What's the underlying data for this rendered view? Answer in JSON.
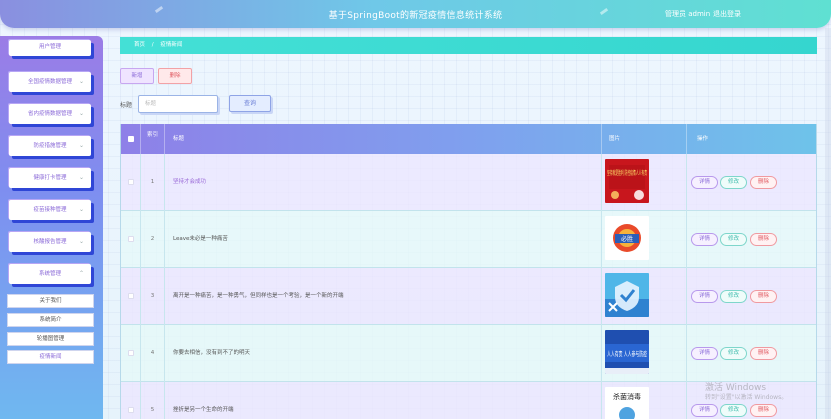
{
  "header": {
    "title": "基于SpringBoot的新冠疫情信息统计系统",
    "user": "管理员 admin",
    "logout": "退出登录"
  },
  "sidebar": {
    "menus": [
      {
        "label": "用户管理"
      },
      {
        "label": "全国疫情数据管理"
      },
      {
        "label": "省内疫情数据管理"
      },
      {
        "label": "防疫措施管理"
      },
      {
        "label": "健康打卡管理"
      },
      {
        "label": "疫苗接种管理"
      },
      {
        "label": "核酸报告管理"
      },
      {
        "label": "系统管理"
      }
    ],
    "submenu": [
      {
        "label": "关于我们"
      },
      {
        "label": "系统简介"
      },
      {
        "label": "轮播图管理"
      },
      {
        "label": "疫情新闻"
      }
    ]
  },
  "breadcrumb": {
    "home": "首页",
    "current": "疫情新闻"
  },
  "toolbar": {
    "add": "新增",
    "delete": "删除"
  },
  "search": {
    "label": "标题",
    "placeholder": "标题",
    "button": "查询"
  },
  "table": {
    "headers": {
      "index": "索引",
      "title": "标题",
      "image": "图片",
      "ops": "操作"
    },
    "rows": [
      {
        "index": "1",
        "title": "坚持才会成功"
      },
      {
        "index": "2",
        "title": "Leave未必是一种痛苦"
      },
      {
        "index": "3",
        "title": "离开是一种痛苦，是一种勇气，但同样也是一个考验，是一个新的开端"
      },
      {
        "index": "4",
        "title": "你要去相信，没有到不了的明天"
      },
      {
        "index": "5",
        "title": "挫折是另一个生命的开端"
      }
    ],
    "ops": {
      "detail": "详情",
      "edit": "修改",
      "delete": "删除"
    }
  },
  "images": {
    "img1": "坚持就是胜利 防控疫情人人有责",
    "img2": "必胜",
    "img4": "人人有责 人人参与防疫",
    "img5": "杀菌消毒"
  },
  "watermark": {
    "line1": "激活 Windows",
    "line2": "转到\"设置\"以激活 Windows。"
  },
  "colors": {
    "accent": "#8b6ad8",
    "teal": "#35d6cf",
    "danger": "#e05b63"
  }
}
